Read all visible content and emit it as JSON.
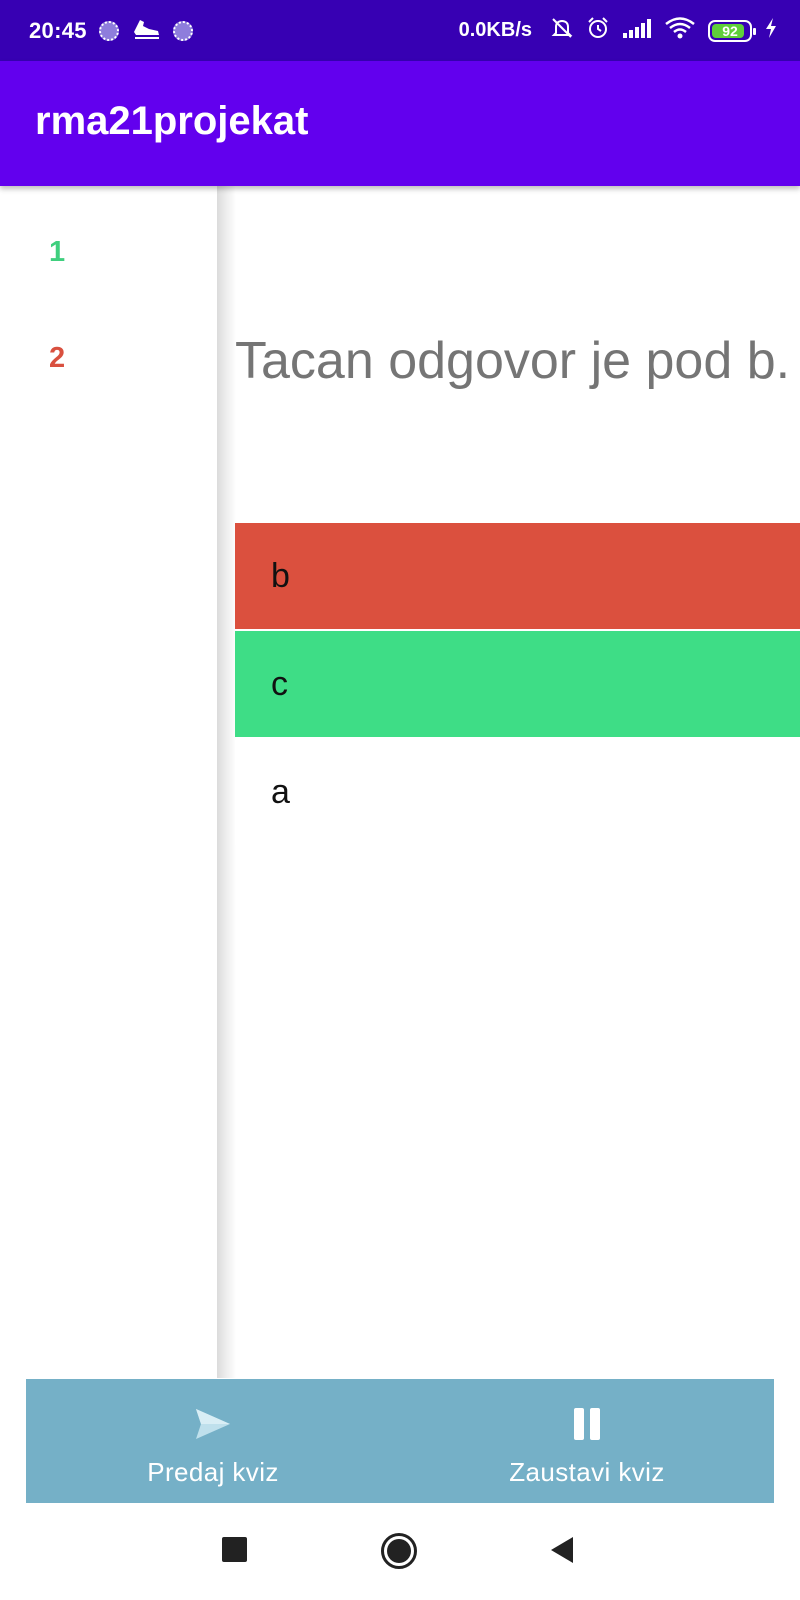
{
  "status_bar": {
    "time": "20:45",
    "network_speed": "0.0KB/s",
    "battery_level": "92",
    "icons": [
      "notification-dot-icon",
      "sneaker-icon",
      "notification-dot-icon",
      "bell-off-icon",
      "alarm-icon",
      "signal-icon",
      "wifi-icon",
      "battery-icon",
      "charging-icon"
    ]
  },
  "app_bar": {
    "title": "rma21projekat"
  },
  "question_list": {
    "items": [
      {
        "label": "1",
        "color": "#3fcf7e"
      },
      {
        "label": "2",
        "color": "#d9503f"
      }
    ]
  },
  "question": {
    "text": "Tacan odgovor je pod b."
  },
  "answers": [
    {
      "label": "b",
      "background": "#db503e",
      "state": "wrong"
    },
    {
      "label": "c",
      "background": "#3edd86",
      "state": "correct"
    },
    {
      "label": "a",
      "background": "#ffffff",
      "state": "neutral"
    }
  ],
  "bottom_nav": {
    "background": "#75b0c7",
    "submit_label": "Predaj kviz",
    "submit_icon": "send-icon",
    "pause_label": "Zaustavi kviz",
    "pause_icon": "pause-icon"
  },
  "system_nav": {
    "icons": [
      "recents-icon",
      "home-icon",
      "back-icon"
    ]
  },
  "colors": {
    "status_bar": "#3700b3",
    "app_bar": "#6200ee"
  }
}
